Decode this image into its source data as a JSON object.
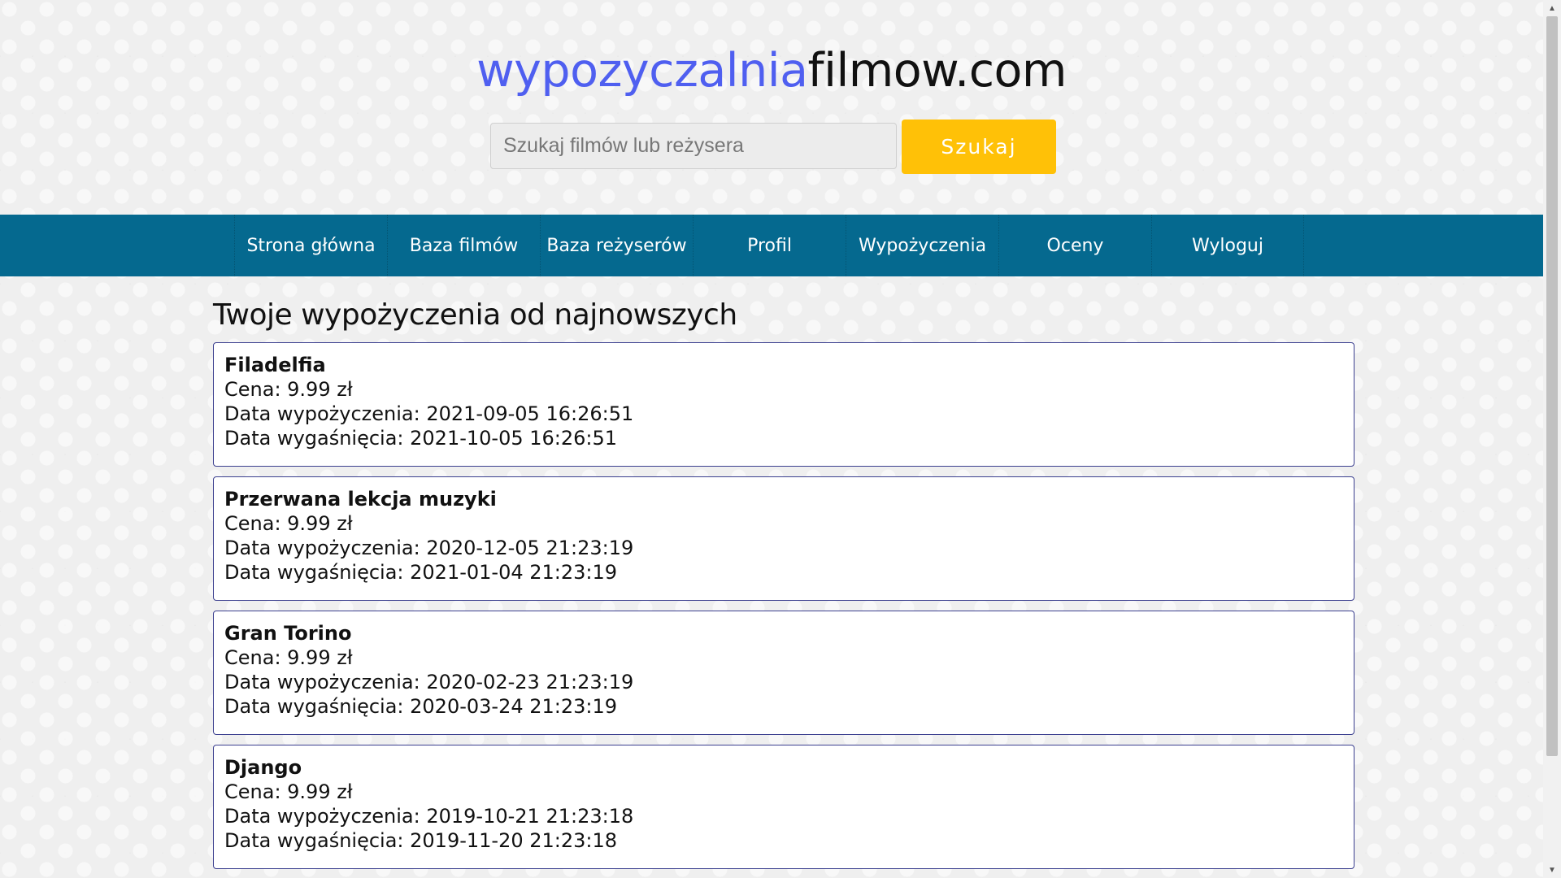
{
  "logo": {
    "accent": "wypozyczalnia",
    "rest": "filmow.com"
  },
  "search": {
    "placeholder": "Szukaj filmów lub reżysera",
    "button_label": "Szukaj"
  },
  "nav": {
    "items": [
      {
        "label": "Strona główna"
      },
      {
        "label": "Baza filmów"
      },
      {
        "label": "Baza reżyserów"
      },
      {
        "label": "Profil"
      },
      {
        "label": "Wypożyczenia"
      },
      {
        "label": "Oceny"
      },
      {
        "label": "Wyloguj"
      }
    ]
  },
  "main": {
    "title": "Twoje wypożyczenia od najnowszych",
    "rentals": [
      {
        "title": "Filadelfia",
        "price": "Cena: 9.99 zł",
        "rented": "Data wypożyczenia: 2021-09-05 16:26:51",
        "expires": "Data wygaśnięcia: 2021-10-05 16:26:51"
      },
      {
        "title": "Przerwana lekcja muzyki",
        "price": "Cena: 9.99 zł",
        "rented": "Data wypożyczenia: 2020-12-05 21:23:19",
        "expires": "Data wygaśnięcia: 2021-01-04 21:23:19"
      },
      {
        "title": "Gran Torino",
        "price": "Cena: 9.99 zł",
        "rented": "Data wypożyczenia: 2020-02-23 21:23:19",
        "expires": "Data wygaśnięcia: 2020-03-24 21:23:19"
      },
      {
        "title": "Django",
        "price": "Cena: 9.99 zł",
        "rented": "Data wypożyczenia: 2019-10-21 21:23:18",
        "expires": "Data wygaśnięcia: 2019-11-20 21:23:18"
      }
    ]
  },
  "colors": {
    "logo_accent": "#4f5ff0",
    "nav_background": "#05698f",
    "search_button": "#ffc107",
    "card_border": "#3b3f8f"
  },
  "icons": {
    "scroll_up": "scroll-up-arrow-icon",
    "scroll_down": "scroll-down-arrow-icon"
  }
}
